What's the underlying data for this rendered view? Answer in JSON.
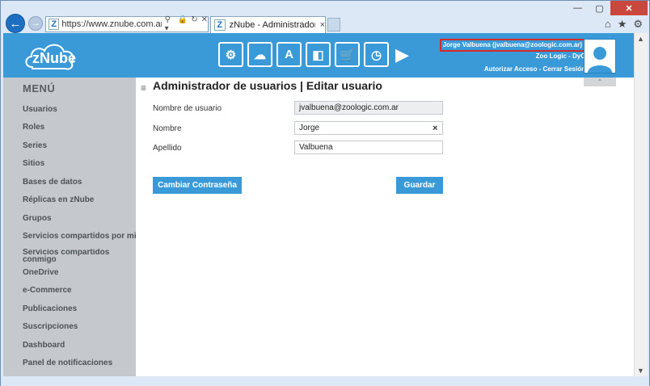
{
  "browser": {
    "url": "https://www.znube.com.ar/AccessM",
    "tab_title": "zNube - Administrador de ...",
    "tab_close": "×",
    "back_glyph": "←",
    "forward_glyph": "→",
    "addr_icons": [
      "⚲ ▾",
      "🔒",
      "↻",
      "✕"
    ],
    "window_controls": {
      "minimize": "—",
      "maximize": "▢",
      "close": "✕"
    },
    "toolbar_icons": [
      "⌂",
      "★",
      "⚙"
    ],
    "scroll_up": "▲",
    "scroll_down": "▼"
  },
  "header": {
    "logo_text": "zNube",
    "module_icons": [
      "user-gear-icon",
      "cloud-gear-icon",
      "font-icon",
      "box-icon",
      "cart-icon",
      "clock-icon"
    ],
    "module_glyphs": [
      "⚙",
      "☁",
      "A",
      "◧",
      "🛒",
      "◷"
    ],
    "next_glyph": "▶",
    "user_name": "Jorge Valbuena (jvalbuena@zoologic.com.ar)",
    "company": "Zoo Logic - DyC",
    "authorize_link": "Autorizar Acceso",
    "separator": "-",
    "logout_link": "Cerrar Sesión"
  },
  "sidebar": {
    "title": "MENÚ",
    "items": [
      "Usuarios",
      "Roles",
      "Series",
      "Sitios",
      "Bases de datos",
      "Réplicas en zNube",
      "Grupos",
      "Servicios compartidos por mi",
      "Servicios compartidos conmigo",
      "OneDrive",
      "e-Commerce",
      "Publicaciones",
      "Suscripciones",
      "Dashboard",
      "Panel de notificaciones"
    ]
  },
  "main": {
    "collapse_glyph": "⌃",
    "hamburger": "≡",
    "title": "Administrador de usuarios | Editar usuario",
    "fields": {
      "username_label": "Nombre de usuario",
      "username_value": "jvalbuena@zoologic.com.ar",
      "name_label": "Nombre",
      "name_value": "Jorge",
      "clear_glyph": "×",
      "lastname_label": "Apellido",
      "lastname_value": "Valbuena"
    },
    "change_password_button": "Cambiar Contraseña",
    "save_button": "Guardar"
  }
}
